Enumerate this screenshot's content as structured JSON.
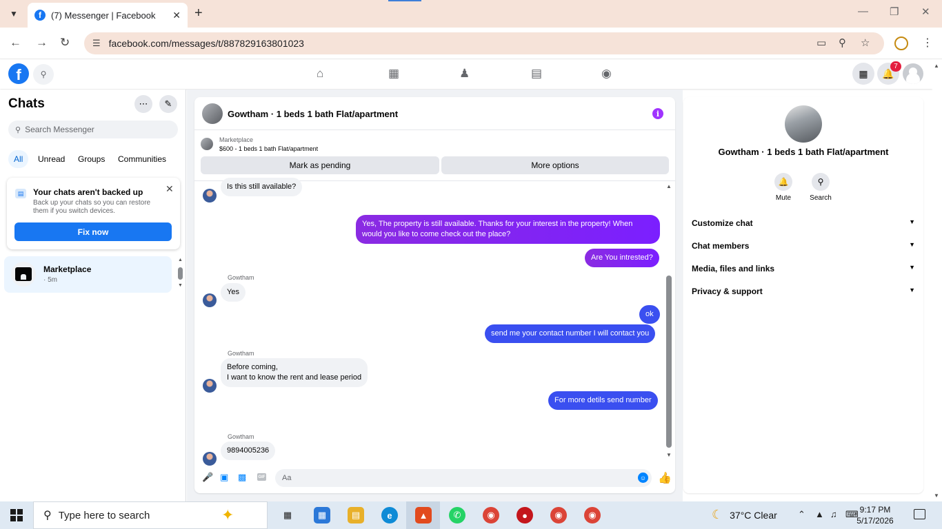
{
  "browser": {
    "tab_title": "(7) Messenger | Facebook",
    "tab_favicon": "f",
    "url": "facebook.com/messages/t/887829163801023",
    "accent": "#f6e3d9"
  },
  "fb": {
    "logo": "f",
    "notification_count": "7",
    "brand_color": "#1877f2"
  },
  "sidebar": {
    "title": "Chats",
    "search_placeholder": "Search Messenger",
    "filters": [
      "All",
      "Unread",
      "Groups",
      "Communities"
    ],
    "backup": {
      "title": "Your chats aren't backed up",
      "description": "Back up your chats so you can restore them if you switch devices.",
      "button": "Fix now"
    },
    "conversation": {
      "name": "Marketplace",
      "time": "· 5m"
    }
  },
  "chat": {
    "header_name": "Gowtham · 1 beds 1 bath Flat/apartment",
    "marketplace_label": "Marketplace",
    "listing": "$600 - 1 beds 1 bath Flat/apartment",
    "mark_pending": "Mark as pending",
    "more_options": "More options",
    "sender": "Gowtham",
    "messages": [
      {
        "text": "Is this still available?"
      },
      {
        "text1": "Yes, The property is still available. Thanks for your interest in the property! When",
        "text2": "would you like to come check out the place?"
      },
      {
        "text": "Are You intrested?"
      },
      {
        "text": "Yes"
      },
      {
        "text": "ok"
      },
      {
        "text": "send me your contact number I will contact you"
      },
      {
        "text1": "Before coming,",
        "text2": "I want to know the rent and lease period"
      },
      {
        "text": "For more detils send number"
      },
      {
        "text": "9894005236"
      }
    ],
    "composer_placeholder": "Aa",
    "gif_label": "GIF"
  },
  "info_panel": {
    "name": "Gowtham · 1 beds 1 bath Flat/apartment",
    "mute": "Mute",
    "search": "Search",
    "sections": [
      "Customize chat",
      "Chat members",
      "Media, files and links",
      "Privacy & support"
    ]
  },
  "taskbar": {
    "search_placeholder": "Type here to search",
    "weather": "37°C  Clear",
    "time": "9:17 PM",
    "date": "5/17/2026"
  }
}
